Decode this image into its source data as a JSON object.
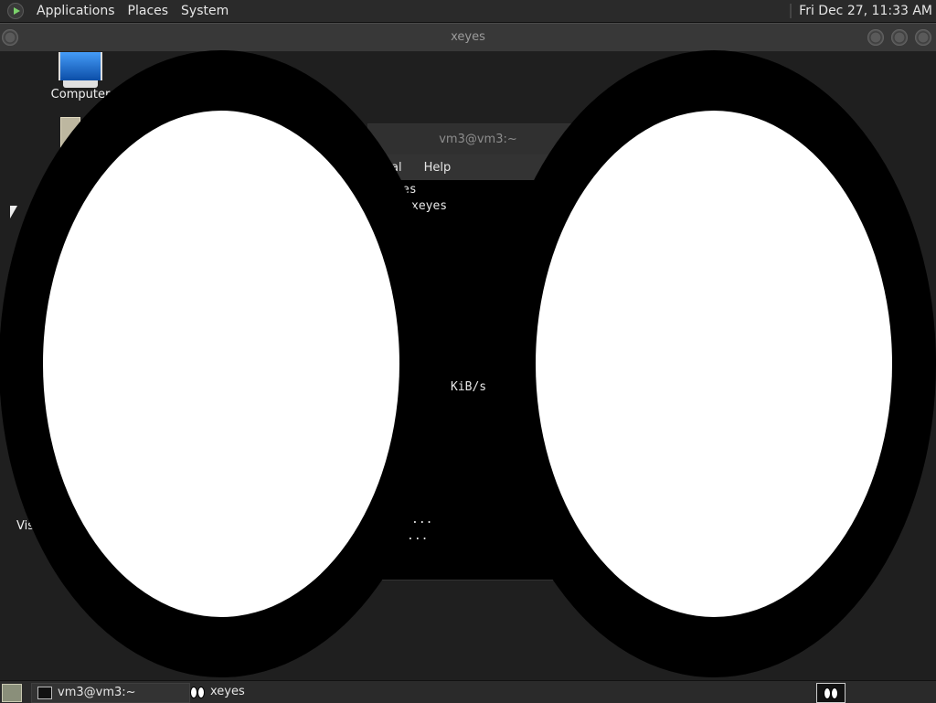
{
  "top_panel": {
    "menu": [
      "Applications",
      "Places",
      "System"
    ],
    "clock": "Fri Dec 27, 11:33 AM"
  },
  "desktop": {
    "icons": [
      {
        "label": "Computer",
        "icon": "computer-icon"
      },
      {
        "label": "",
        "icon": "home-folder-icon"
      },
      {
        "label": "Vis",
        "icon": "partially-hidden-icon"
      }
    ]
  },
  "terminal_window": {
    "title": "vm3@vm3:~",
    "menu": [
      "al",
      "Help"
    ],
    "lines": [
      "es",
      "xeyes",
      "KiB/s",
      "...",
      "..."
    ]
  },
  "xeyes_window": {
    "title": "xeyes",
    "eye_colors": {
      "outline": "#000000",
      "white": "#ffffff"
    }
  },
  "bottom_panel": {
    "tasks": [
      {
        "label": "vm3@vm3:~",
        "icon": "terminal-icon"
      },
      {
        "label": "xeyes",
        "icon": "xeyes-icon"
      }
    ]
  }
}
